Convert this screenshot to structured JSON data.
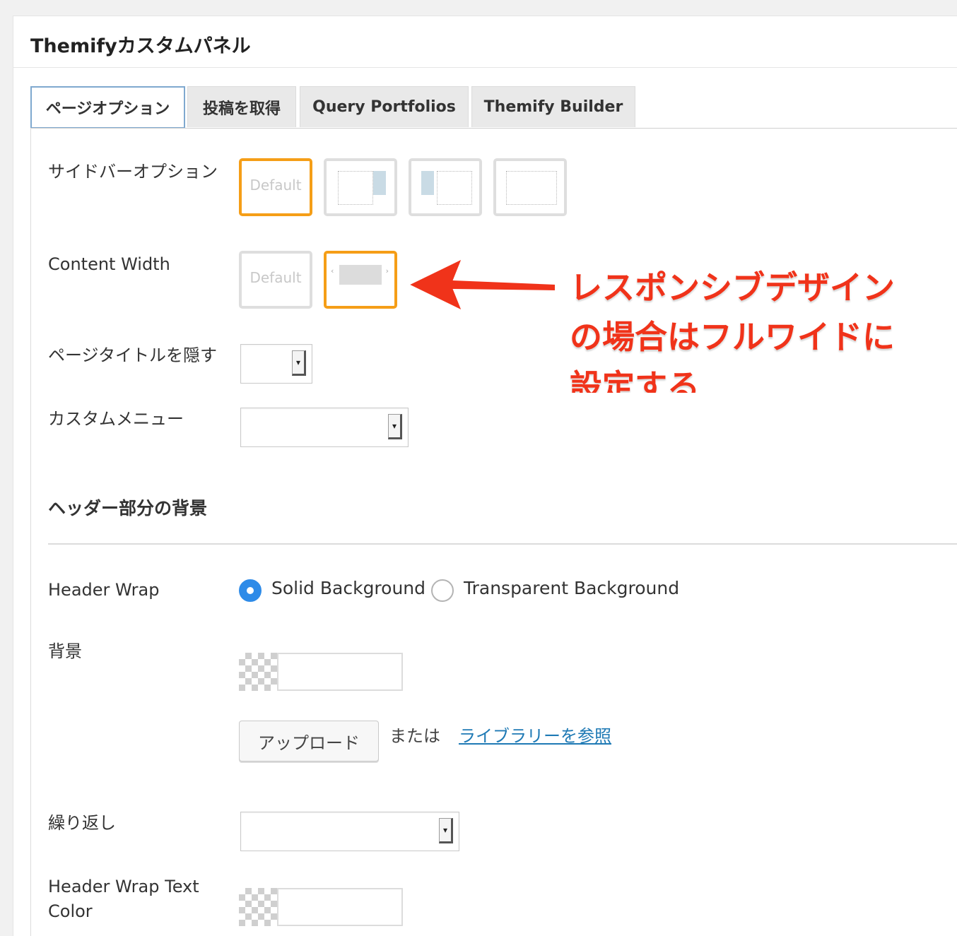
{
  "panel": {
    "title": "Themifyカスタムパネル"
  },
  "tabs": [
    {
      "label": "ページオプション",
      "active": true
    },
    {
      "label": "投稿を取得",
      "active": false
    },
    {
      "label": "Query Portfolios",
      "active": false
    },
    {
      "label": "Themify Builder",
      "active": false
    }
  ],
  "fields": {
    "sidebar_option": {
      "label": "サイドバーオプション",
      "default_label": "Default"
    },
    "content_width": {
      "label": "Content Width",
      "default_label": "Default"
    },
    "hide_page_title": {
      "label": "ページタイトルを隠す"
    },
    "custom_menu": {
      "label": "カスタムメニュー"
    },
    "header_section": {
      "heading": "ヘッダー部分の背景"
    },
    "header_wrap": {
      "label": "Header Wrap",
      "options": [
        "Solid Background",
        "Transparent Background"
      ],
      "selected": "Solid Background"
    },
    "background": {
      "label": "背景",
      "upload_label": "アップロード",
      "or_text": "または",
      "library_link": "ライブラリーを参照"
    },
    "repeat": {
      "label": "繰り返し"
    },
    "header_text_color": {
      "label_line1": "Header Wrap Text",
      "label_line2": "Color"
    }
  },
  "annotation": {
    "lines": [
      "レスポンシブデザイン",
      "の場合はフルワイドに",
      "設定する"
    ],
    "color": "#f0331a"
  },
  "colors": {
    "selected_border": "#f59e17",
    "radio_checked": "#2e8be8",
    "link": "#1f7ab5"
  }
}
